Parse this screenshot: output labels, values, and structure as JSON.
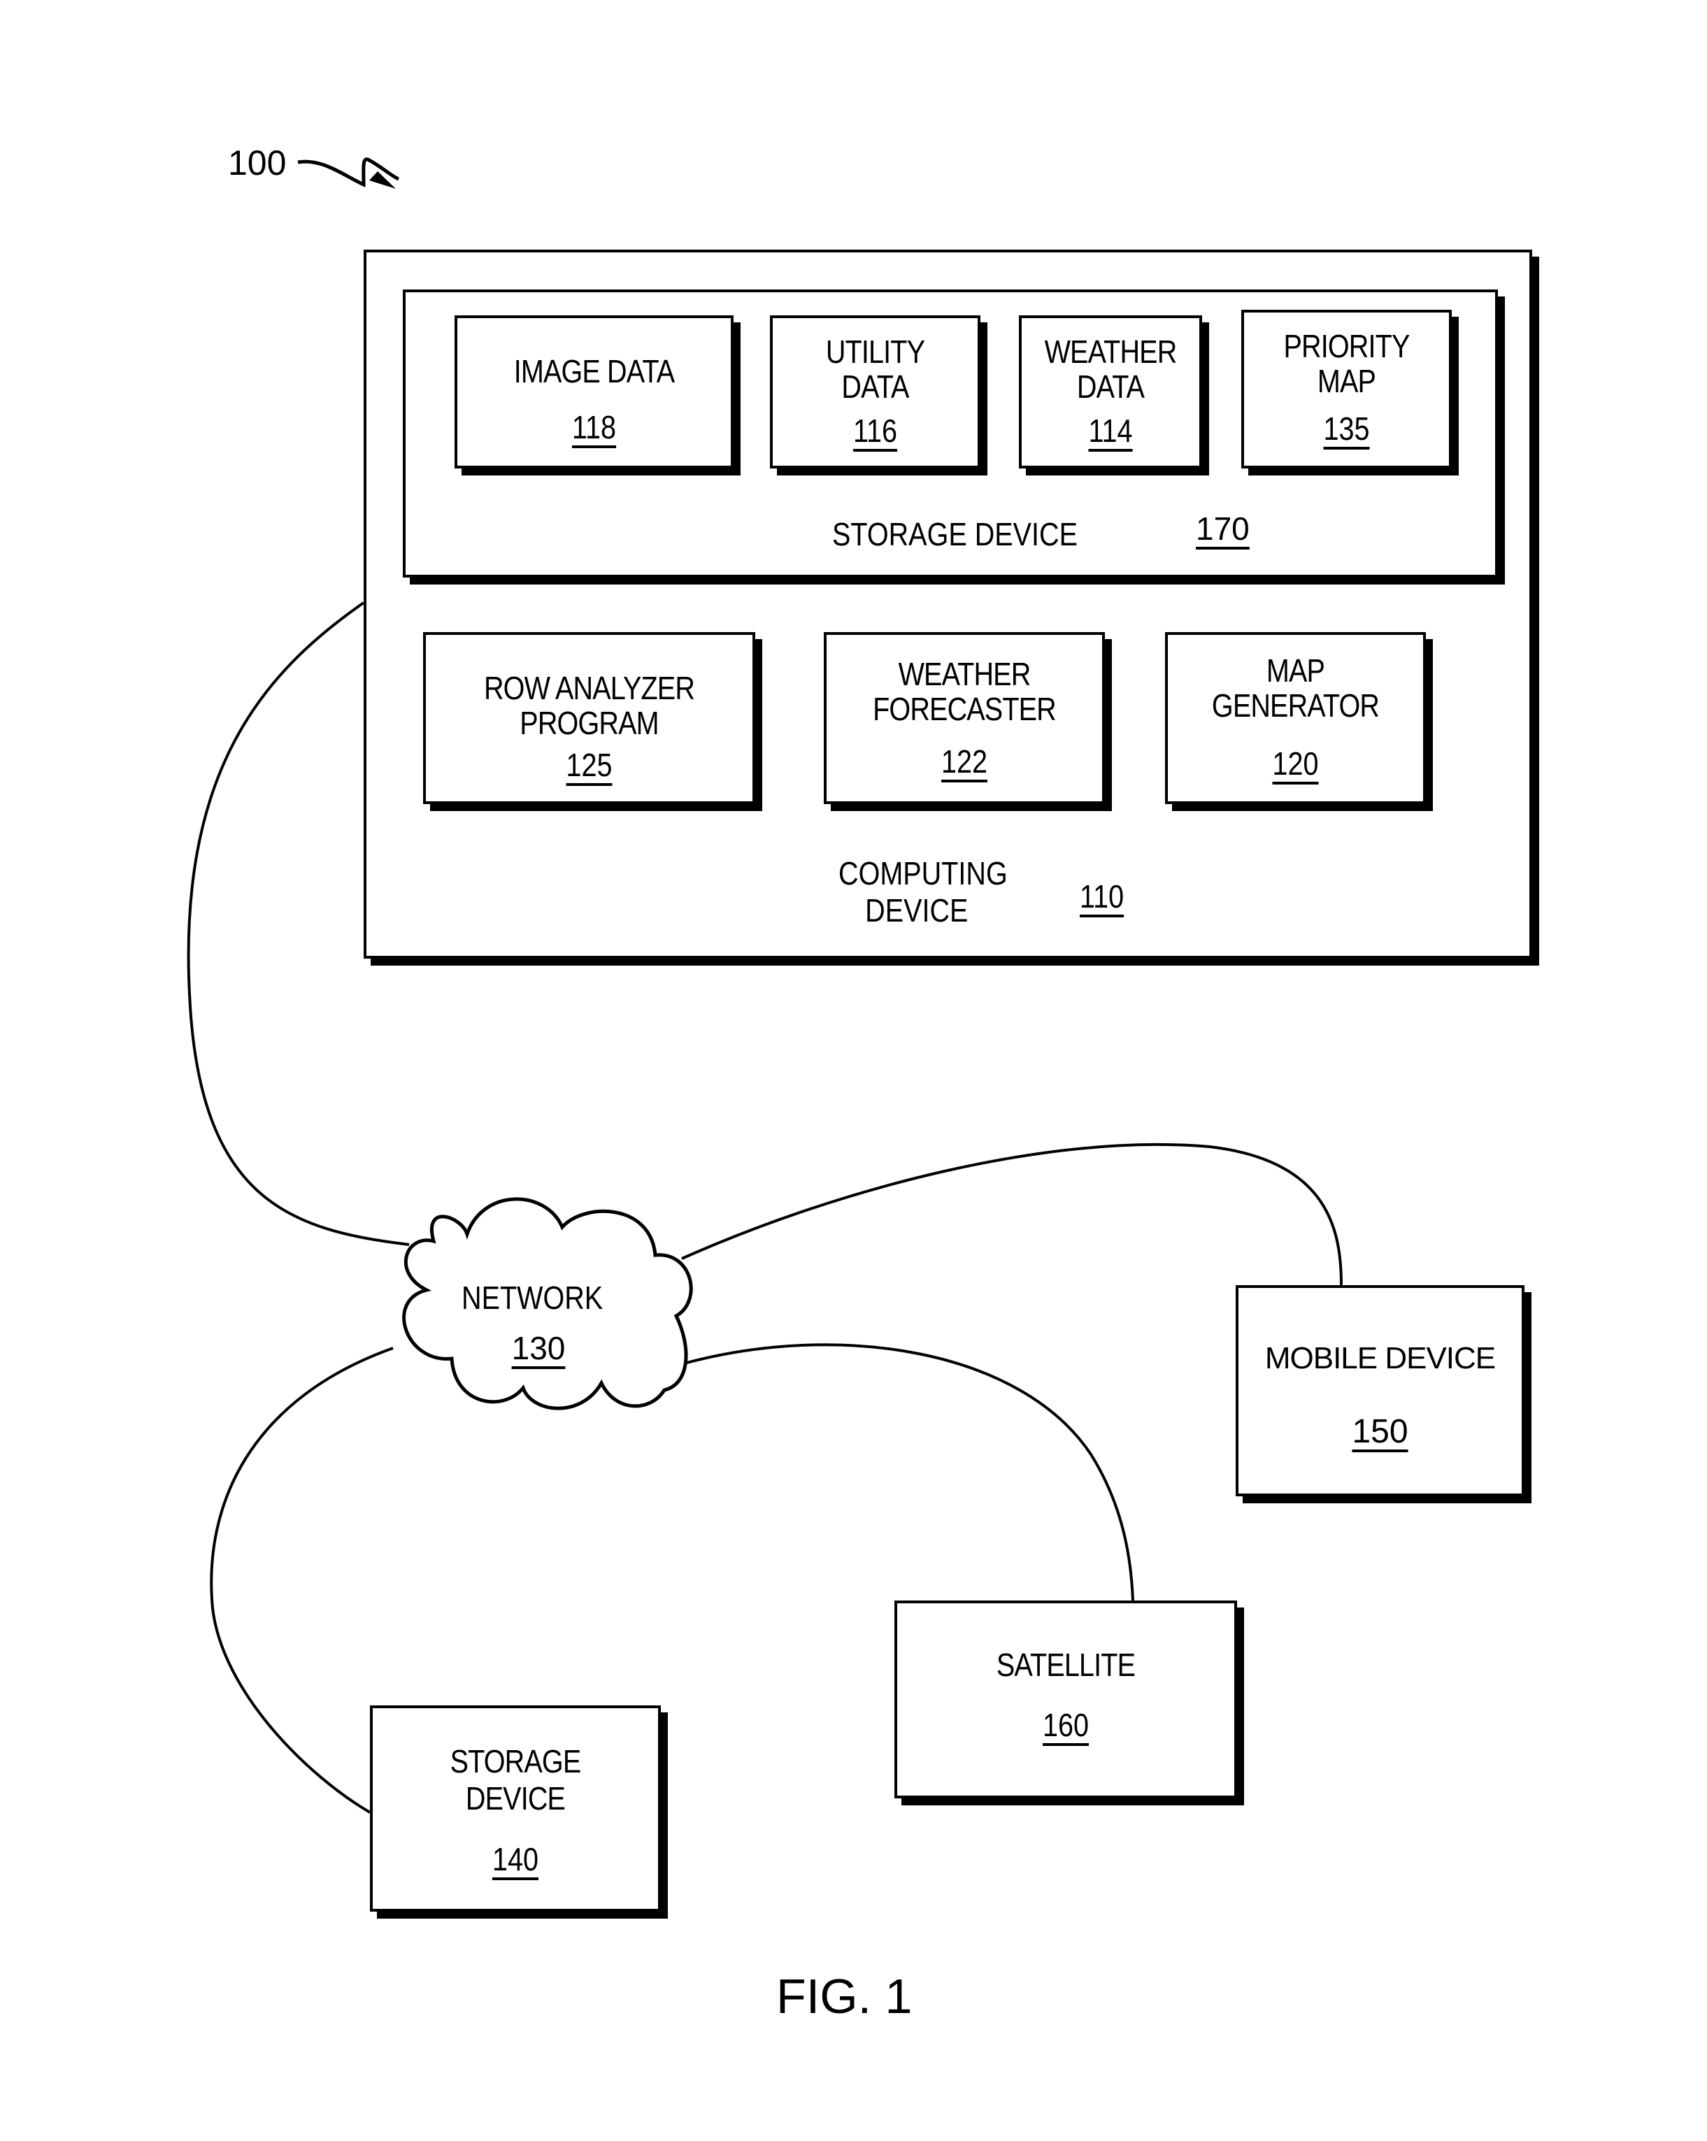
{
  "figure": {
    "reference": "100",
    "caption": "FIG. 1"
  },
  "computing_device": {
    "label": "COMPUTING\nDEVICE",
    "label_line1": "COMPUTING",
    "label_line2": "DEVICE",
    "number": "110",
    "storage_device": {
      "label": "STORAGE DEVICE",
      "number": "170",
      "items": [
        {
          "line1": "IMAGE DATA",
          "line2": "",
          "number": "118"
        },
        {
          "line1": "UTILITY",
          "line2": "DATA",
          "number": "116"
        },
        {
          "line1": "WEATHER",
          "line2": "DATA",
          "number": "114"
        },
        {
          "line1": "PRIORITY",
          "line2": "MAP",
          "number": "135"
        }
      ]
    },
    "programs": [
      {
        "line1": "ROW ANALYZER",
        "line2": "PROGRAM",
        "number": "125"
      },
      {
        "line1": "WEATHER",
        "line2": "FORECASTER",
        "number": "122"
      },
      {
        "line1": "MAP",
        "line2": "GENERATOR",
        "number": "120"
      }
    ]
  },
  "network": {
    "label": "NETWORK",
    "number": "130"
  },
  "mobile_device": {
    "label": "MOBILE DEVICE",
    "number": "150"
  },
  "satellite": {
    "label": "SATELLITE",
    "number": "160"
  },
  "storage_device_external": {
    "line1": "STORAGE",
    "line2": "DEVICE",
    "number": "140"
  }
}
